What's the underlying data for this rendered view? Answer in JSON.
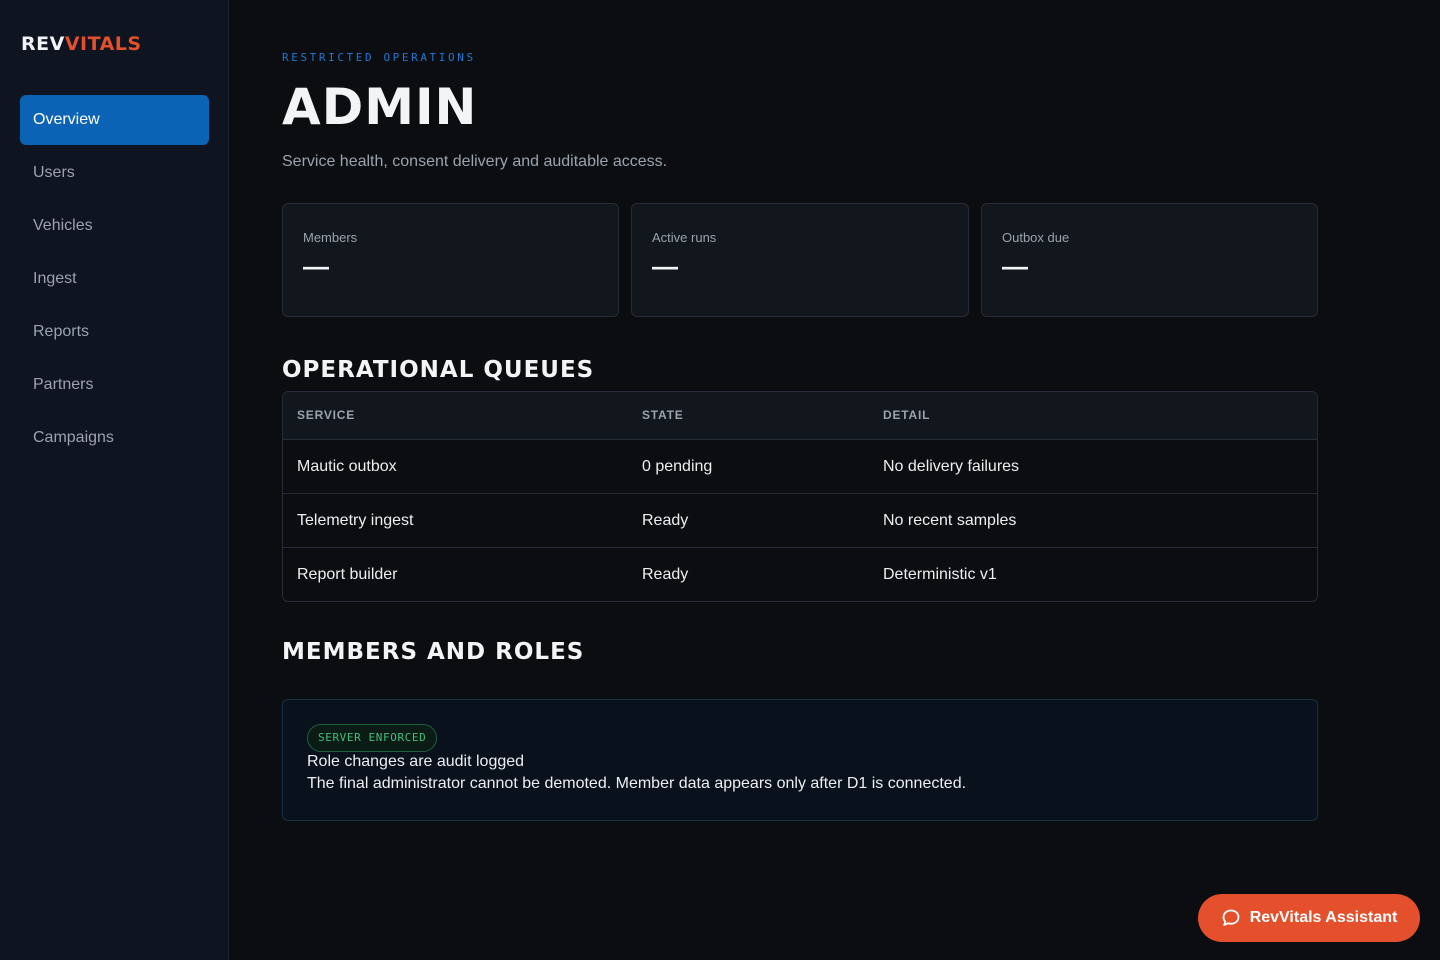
{
  "brand": {
    "part1": "REV",
    "part2": "VITALS"
  },
  "sidebar": {
    "items": [
      {
        "label": "Overview",
        "active": true
      },
      {
        "label": "Users",
        "active": false
      },
      {
        "label": "Vehicles",
        "active": false
      },
      {
        "label": "Ingest",
        "active": false
      },
      {
        "label": "Reports",
        "active": false
      },
      {
        "label": "Partners",
        "active": false
      },
      {
        "label": "Campaigns",
        "active": false
      }
    ]
  },
  "header": {
    "eyebrow": "RESTRICTED OPERATIONS",
    "title": "ADMIN",
    "subtitle": "Service health, consent delivery and auditable access."
  },
  "stats": [
    {
      "label": "Members",
      "value": "—"
    },
    {
      "label": "Active runs",
      "value": "—"
    },
    {
      "label": "Outbox due",
      "value": "—"
    }
  ],
  "queues": {
    "title": "OPERATIONAL QUEUES",
    "columns": [
      "SERVICE",
      "STATE",
      "DETAIL"
    ],
    "rows": [
      [
        "Mautic outbox",
        "0 pending",
        "No delivery failures"
      ],
      [
        "Telemetry ingest",
        "Ready",
        "No recent samples"
      ],
      [
        "Report builder",
        "Ready",
        "Deterministic v1"
      ]
    ]
  },
  "members": {
    "title": "MEMBERS AND ROLES",
    "badge": "SERVER ENFORCED",
    "notice_title": "Role changes are audit logged",
    "notice_body": "The final administrator cannot be demoted. Member data appears only after D1 is connected."
  },
  "assistant": {
    "label": "RevVitals Assistant",
    "icon": "chat-bubble-icon"
  },
  "colors": {
    "accent_blue": "#0b63b6",
    "accent_orange": "#e4502b",
    "success_green": "#3fbf7a"
  }
}
